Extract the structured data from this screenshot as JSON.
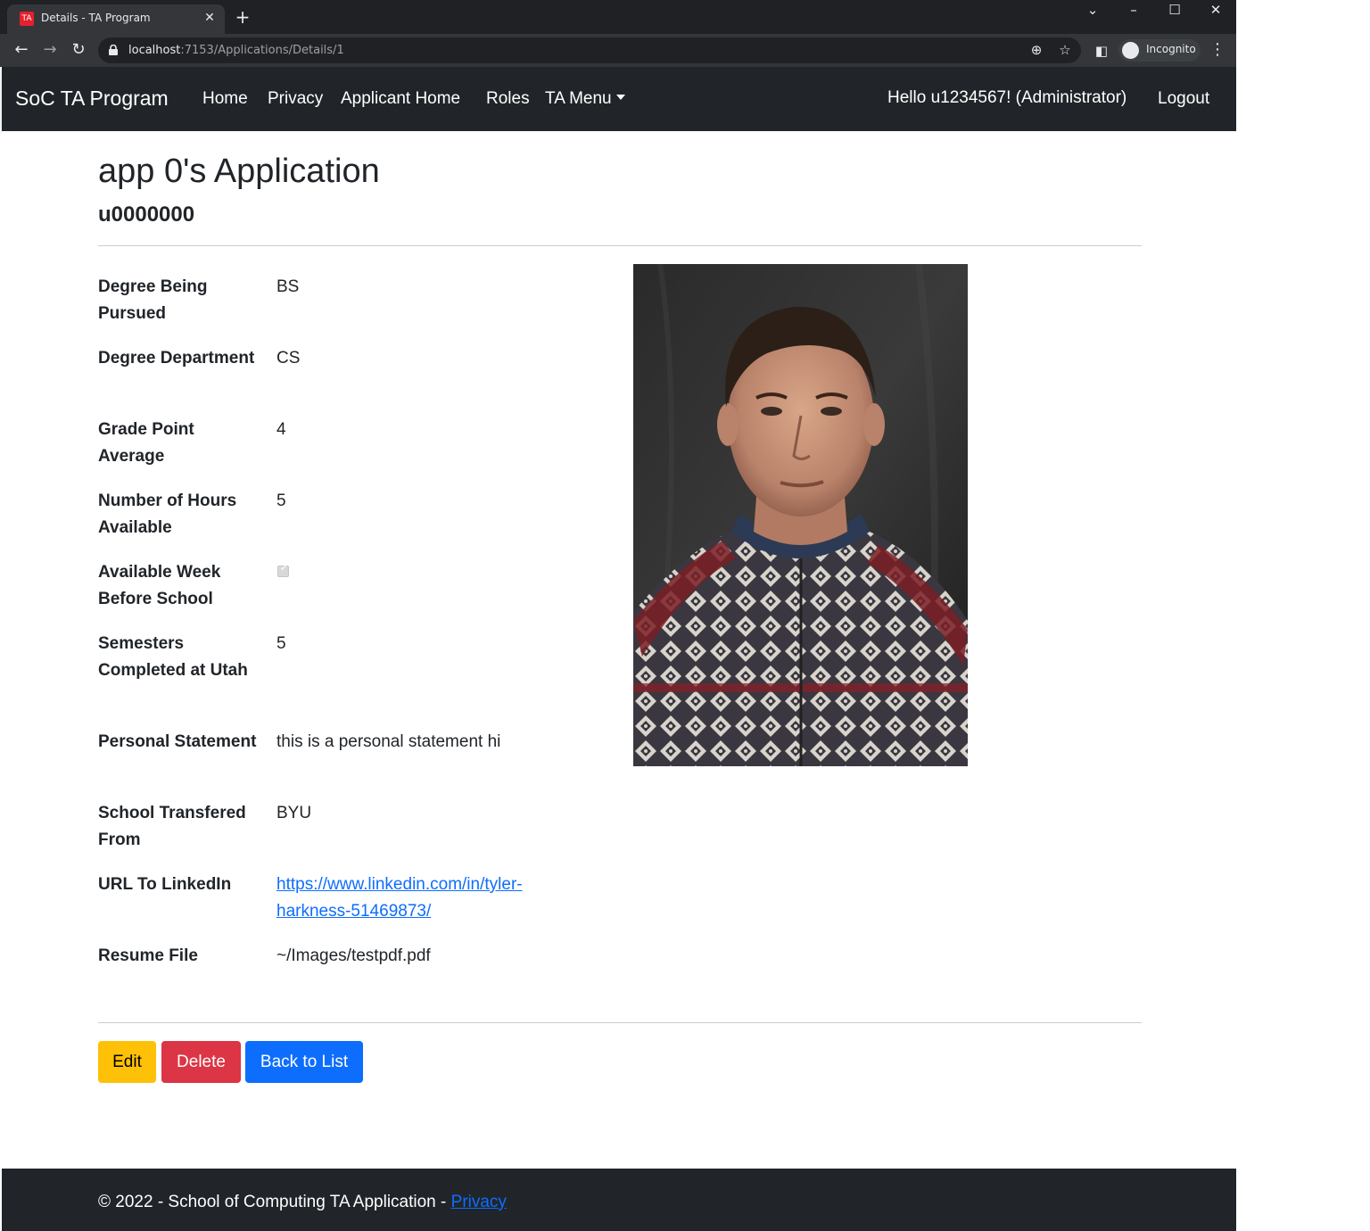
{
  "browser": {
    "tab_title": "Details - TA Program",
    "tab_favicon": "TA",
    "url_host": "localhost",
    "url_rest": ":7153/Applications/Details/1",
    "incognito_label": "Incognito"
  },
  "navbar": {
    "brand": "SoC TA Program",
    "links": [
      "Home",
      "Privacy",
      "Applicant Home",
      "Roles",
      "TA Menu"
    ],
    "greeting": "Hello u1234567! (Administrator)",
    "logout": "Logout"
  },
  "page": {
    "title": "app 0's Application",
    "subtitle": "u0000000"
  },
  "details": {
    "fields": [
      {
        "label": "Degree Being Pursued",
        "value": "BS"
      },
      {
        "label": "Degree Department",
        "value": "CS"
      },
      {
        "label": "Grade Point Average",
        "value": "4"
      },
      {
        "label": "Number of Hours Available",
        "value": "5"
      },
      {
        "label": "Available Week Before School",
        "value": "",
        "checked": true
      },
      {
        "label": "Semesters Completed at Utah",
        "value": "5"
      },
      {
        "label": "Personal Statement",
        "value": "this is a personal statement hi"
      },
      {
        "label": "School Transfered From",
        "value": "BYU"
      },
      {
        "label": "URL To LinkedIn",
        "value": "https://www.linkedin.com/in/tyler-harkness-51469873/"
      },
      {
        "label": "Resume File",
        "value": "~/Images/testpdf.pdf"
      }
    ]
  },
  "actions": {
    "edit": "Edit",
    "delete": "Delete",
    "back": "Back to List"
  },
  "footer": {
    "text": "© 2022 - School of Computing TA Application - ",
    "privacy": "Privacy"
  },
  "colors": {
    "navbar_bg": "#212529",
    "edit_btn": "#ffc107",
    "delete_btn": "#dc3545",
    "back_btn": "#0d6efd",
    "link": "#0d6efd"
  }
}
